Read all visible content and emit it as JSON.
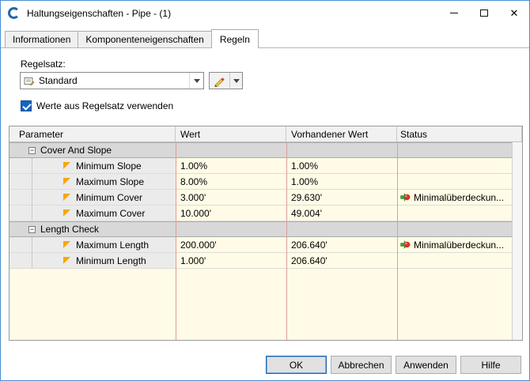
{
  "window": {
    "title": "Haltungseigenschaften - Pipe - (1)"
  },
  "icons": {
    "close": "✕",
    "expander_collapse": "−"
  },
  "tabs": [
    {
      "label": "Informationen",
      "active": false
    },
    {
      "label": "Komponenteneigenschaften",
      "active": false
    },
    {
      "label": "Regeln",
      "active": true
    }
  ],
  "ruleset": {
    "label": "Regelsatz:",
    "value": "Standard"
  },
  "use_ruleset_checkbox": {
    "label": "Werte aus Regelsatz verwenden",
    "checked": true
  },
  "table": {
    "headers": [
      "Parameter",
      "Wert",
      "Vorhandener Wert",
      "Status"
    ],
    "rows": [
      {
        "type": "group",
        "label": "Cover And Slope"
      },
      {
        "type": "item",
        "label": "Minimum Slope",
        "wert": "1.00%",
        "vorhandener_wert": "1.00%",
        "status": ""
      },
      {
        "type": "item",
        "label": "Maximum Slope",
        "wert": "8.00%",
        "vorhandener_wert": "1.00%",
        "status": ""
      },
      {
        "type": "item",
        "label": "Minimum Cover",
        "wert": "3.000'",
        "vorhandener_wert": "29.630'",
        "status": "Minimalüberdeckun...",
        "status_icon": "violation-icon"
      },
      {
        "type": "item",
        "label": "Maximum Cover",
        "wert": "10.000'",
        "vorhandener_wert": "49.004'",
        "status": ""
      },
      {
        "type": "group",
        "label": "Length Check"
      },
      {
        "type": "item",
        "label": "Maximum Length",
        "wert": "200.000'",
        "vorhandener_wert": "206.640'",
        "status": "Minimalüberdeckun...",
        "status_icon": "violation-icon"
      },
      {
        "type": "item",
        "label": "Minimum Length",
        "wert": "1.000'",
        "vorhandener_wert": "206.640'",
        "status": ""
      }
    ]
  },
  "buttons": {
    "ok": "OK",
    "cancel": "Abbrechen",
    "apply": "Anwenden",
    "help": "Hilfe"
  },
  "colors": {
    "accent": "#2468a8",
    "window_border": "#4a8fd0",
    "grid_line_red": "#dc9e9c",
    "cell_yellow": "#fffbe6",
    "group_gray": "#d8d8d8",
    "param_gray": "#ebebeb",
    "flag_orange": "#f5a800"
  }
}
